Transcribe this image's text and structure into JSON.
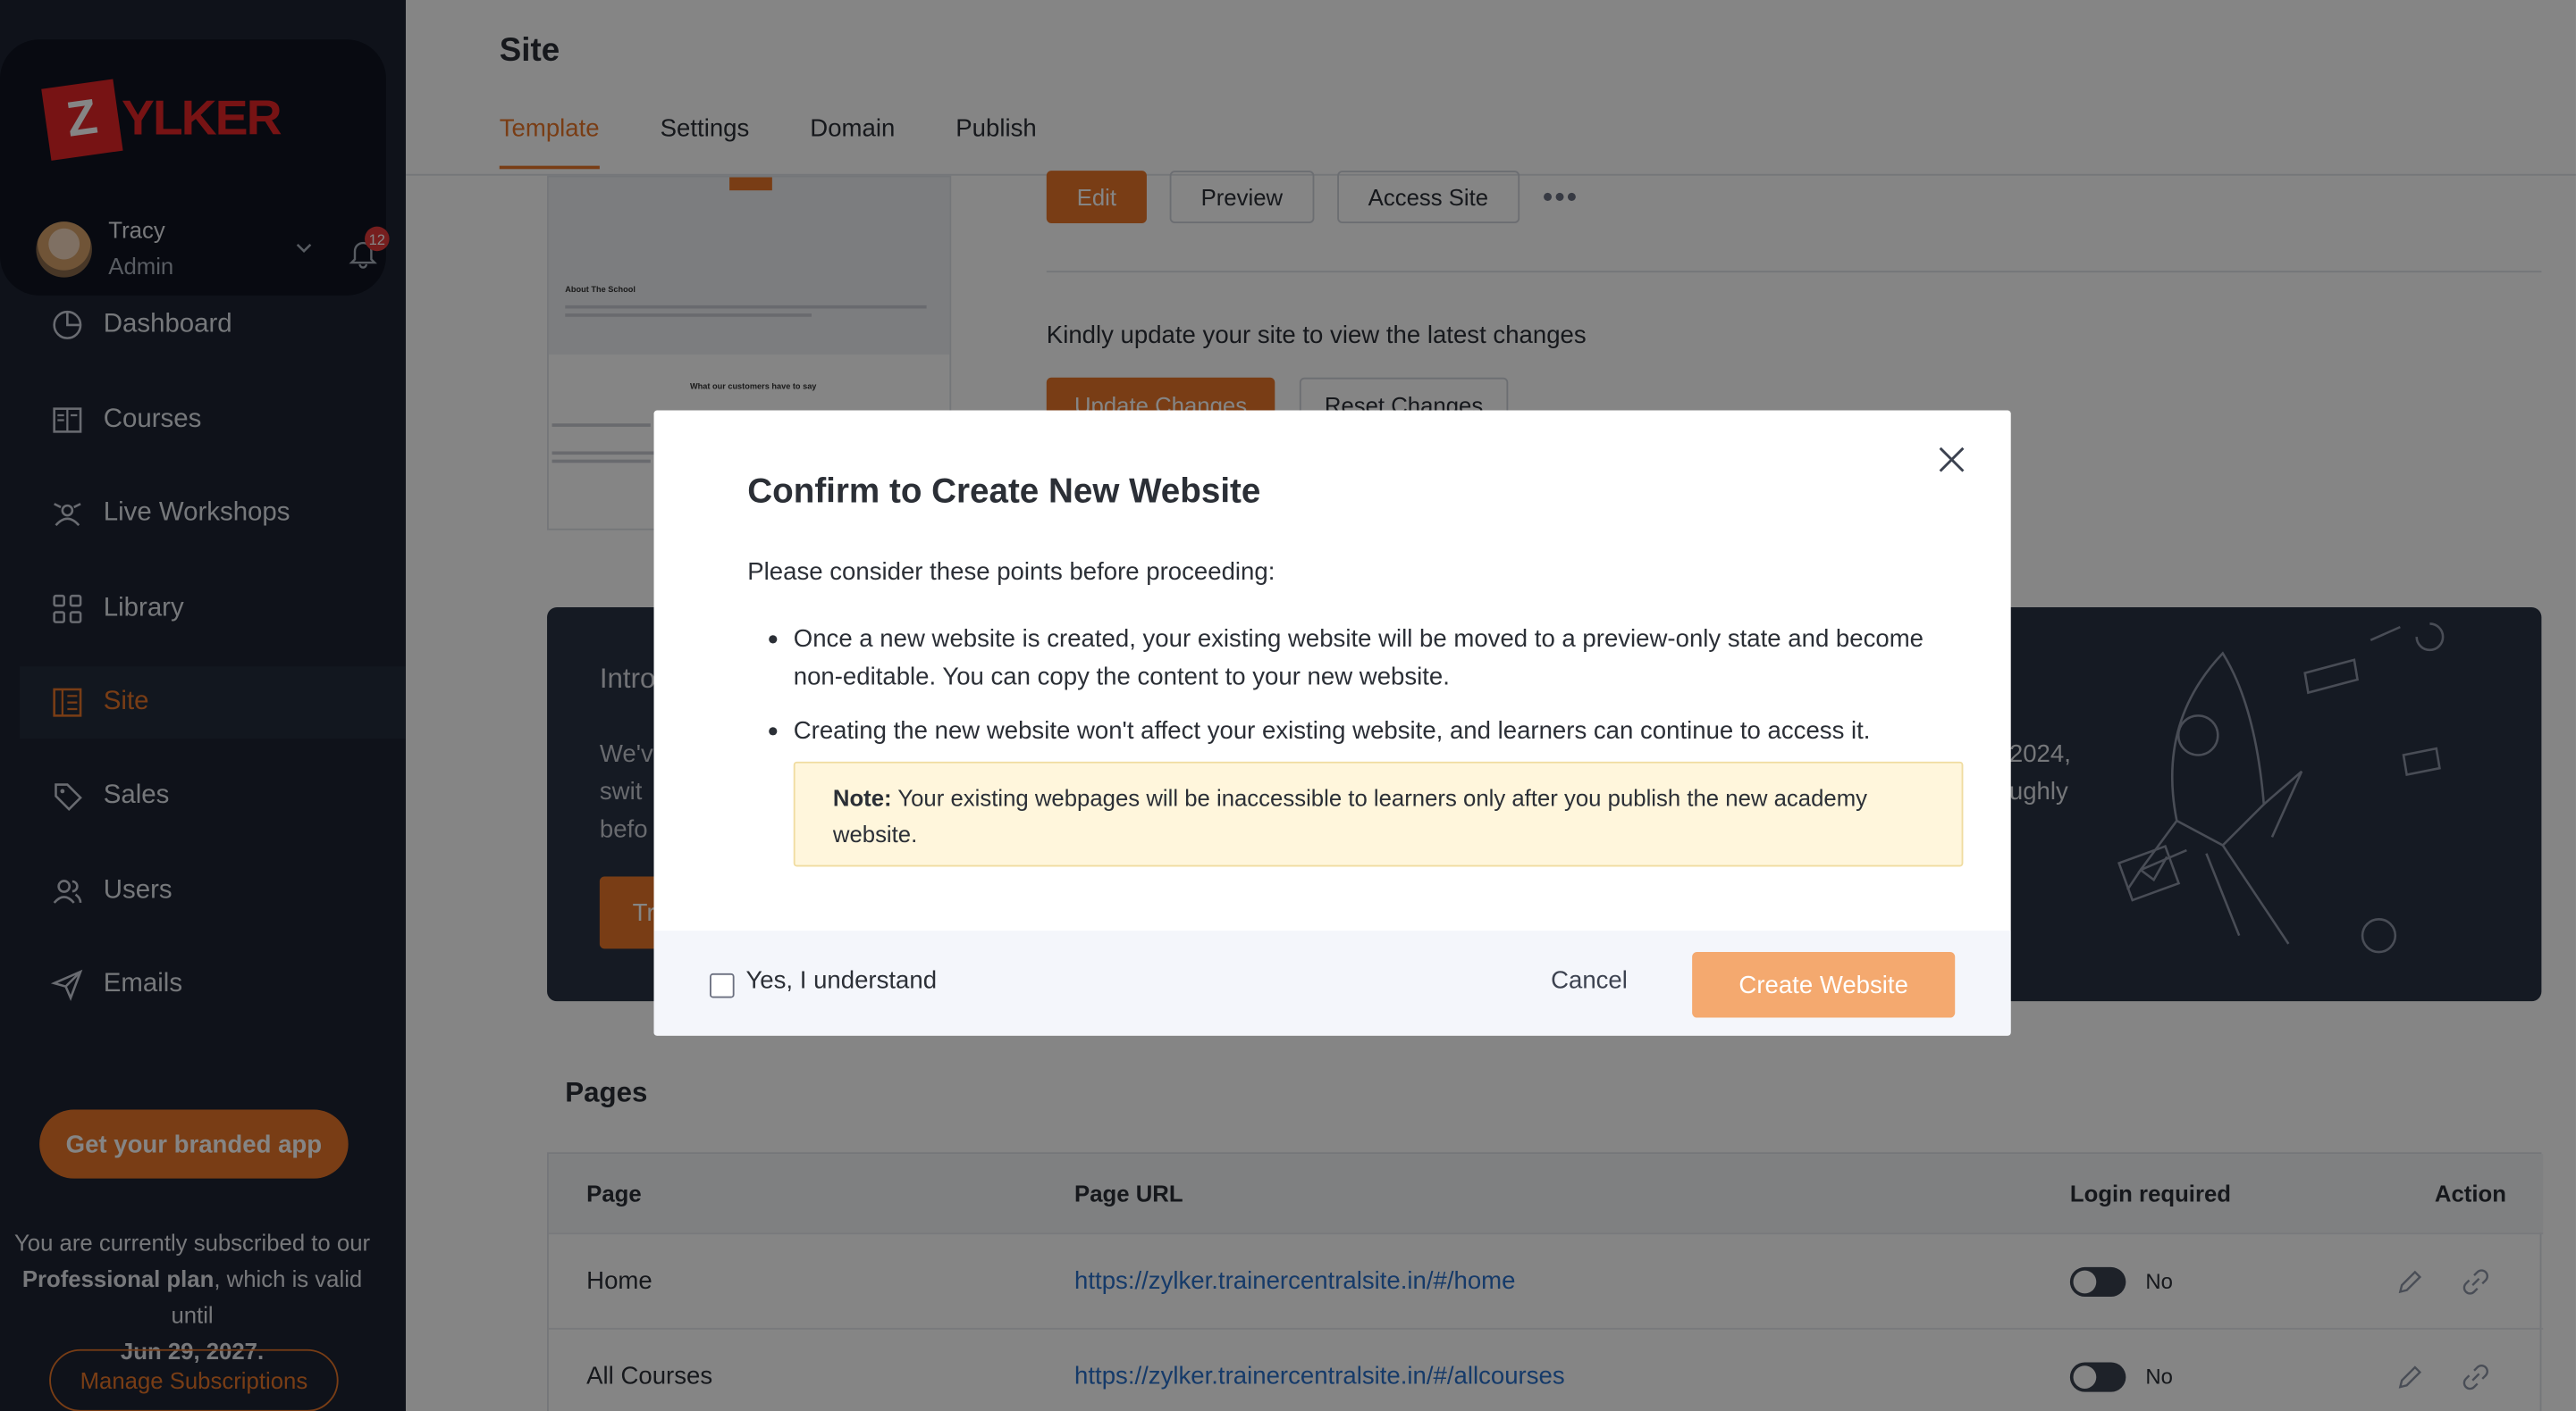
{
  "brand": {
    "logo_z": "Z",
    "logo_rest": "YLKER"
  },
  "user": {
    "name": "Tracy",
    "role": "Admin",
    "notifications": "12"
  },
  "nav": [
    {
      "label": "Dashboard",
      "icon": "dashboard-icon"
    },
    {
      "label": "Courses",
      "icon": "courses-icon"
    },
    {
      "label": "Live Workshops",
      "icon": "live-workshops-icon"
    },
    {
      "label": "Library",
      "icon": "library-icon"
    },
    {
      "label": "Site",
      "icon": "site-icon",
      "active": true
    },
    {
      "label": "Sales",
      "icon": "tag-icon"
    },
    {
      "label": "Users",
      "icon": "users-icon"
    },
    {
      "label": "Emails",
      "icon": "send-icon"
    }
  ],
  "sidebar": {
    "branded_app_button": "Get your branded app",
    "sub_text_1": "You are currently subscribed to our",
    "sub_plan": "Professional plan",
    "sub_text_2": ", which is valid until",
    "sub_date": "Jun 29, 2027.",
    "manage_button": "Manage Subscriptions"
  },
  "header": {
    "title": "Site",
    "tabs": [
      "Template",
      "Settings",
      "Domain",
      "Publish"
    ],
    "active_tab": "Template"
  },
  "thumbnail": {
    "about": "About The School",
    "customers": "What our customers have to say"
  },
  "actions": {
    "edit": "Edit",
    "preview": "Preview",
    "access_site": "Access Site",
    "more": "•••"
  },
  "update_notice": "Kindly update your site to view the latest changes",
  "update_button": "Update Changes",
  "reset_button": "Reset Changes",
  "banner": {
    "title": "Intro",
    "body_1": "We'v",
    "body_2": "swit",
    "body_3": "befo",
    "button": "Tr",
    "right_1": "2024,",
    "right_2": "ughly"
  },
  "pages": {
    "title": "Pages",
    "columns": [
      "Page",
      "Page URL",
      "Login required",
      "Action"
    ],
    "rows": [
      {
        "page": "Home",
        "url": "https://zylker.trainercentralsite.in/#/home",
        "login": "No"
      },
      {
        "page": "All Courses",
        "url": "https://zylker.trainercentralsite.in/#/allcourses",
        "login": "No"
      }
    ]
  },
  "modal": {
    "title": "Confirm to Create New Website",
    "intro": "Please consider these points before proceeding:",
    "points": [
      "Once a new website is created, your existing website will be moved to a preview-only state and become non-editable. You can copy the content to your new website.",
      "Creating the new website won't affect your existing website, and learners can continue to access it."
    ],
    "note_label": "Note:",
    "note_text": " Your existing webpages will be inaccessible to learners only after you publish the new academy website.",
    "checkbox_label": "Yes, I understand",
    "cancel": "Cancel",
    "create": "Create Website"
  }
}
